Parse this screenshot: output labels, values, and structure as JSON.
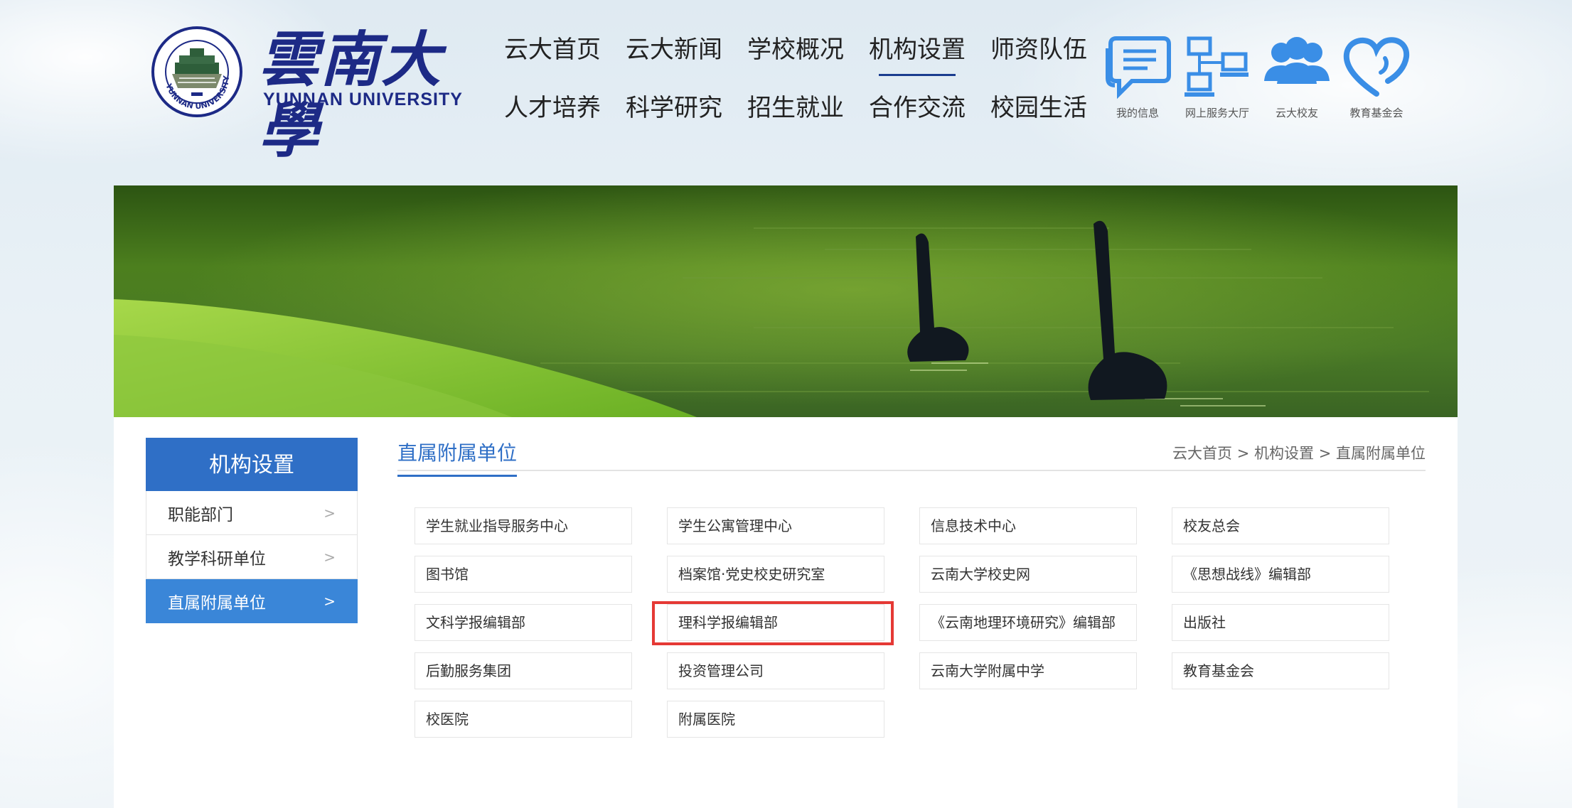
{
  "header": {
    "logo_cn": "雲南大學",
    "logo_en": "YUNNAN UNIVERSITY",
    "seal_ring_text": "YUNNAN UNIVERSITY",
    "nav": [
      [
        "云大首页",
        "云大新闻",
        "学校概况",
        "机构设置",
        "师资队伍"
      ],
      [
        "人才培养",
        "科学研究",
        "招生就业",
        "合作交流",
        "校园生活"
      ]
    ],
    "nav_active": "机构设置",
    "quick_links": [
      {
        "label": "我的信息",
        "icon": "message-icon"
      },
      {
        "label": "网上服务大厅",
        "icon": "network-service-icon"
      },
      {
        "label": "云大校友",
        "icon": "alumni-icon"
      },
      {
        "label": "教育基金会",
        "icon": "heart-icon"
      }
    ]
  },
  "sidebar": {
    "title": "机构设置",
    "items": [
      {
        "label": "职能部门",
        "chevron": ">"
      },
      {
        "label": "教学科研单位",
        "chevron": ">"
      },
      {
        "label": "直属附属单位",
        "chevron": ">"
      }
    ],
    "active": "直属附属单位"
  },
  "content": {
    "heading": "直属附属单位",
    "breadcrumb": [
      "云大首页",
      "机构设置",
      "直属附属单位"
    ],
    "breadcrumb_sep": ">",
    "units": [
      "学生就业指导服务中心",
      "学生公寓管理中心",
      "信息技术中心",
      "校友总会",
      "图书馆",
      "档案馆·党史校史研究室",
      "云南大学校史网",
      "《思想战线》编辑部",
      "文科学报编辑部",
      "理科学报编辑部",
      "《云南地理环境研究》编辑部",
      "出版社",
      "后勤服务集团",
      "投资管理公司",
      "云南大学附属中学",
      "教育基金会",
      "校医院",
      "附属医院"
    ],
    "highlighted_unit": "理科学报编辑部"
  },
  "colors": {
    "brand_navy": "#1d2a86",
    "accent_blue": "#2f6fc6",
    "active_blue": "#3a86d8",
    "highlight_red": "#e53935",
    "icon_blue": "#3a8ee6"
  }
}
